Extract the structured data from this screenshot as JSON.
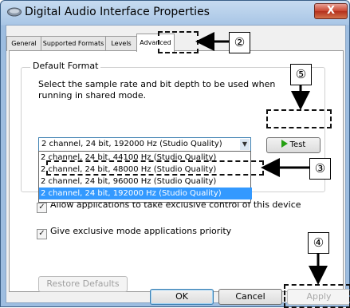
{
  "window": {
    "title": "Digital Audio Interface Properties",
    "close_label": "X"
  },
  "tabs": [
    {
      "label": "General"
    },
    {
      "label": "Supported Formats"
    },
    {
      "label": "Levels"
    },
    {
      "label": "Advanced",
      "active": true
    }
  ],
  "default_format": {
    "group_label": "Default Format",
    "description": "Select the sample rate and bit depth to be used when running in shared mode.",
    "selected_value": "2 channel, 24 bit, 192000 Hz (Studio Quality)",
    "options": [
      "2 channel, 24 bit, 44100 Hz (Studio Quality)",
      "2 channel, 24 bit, 48000 Hz (Studio Quality)",
      "2 channel, 24 bit, 96000 Hz (Studio Quality)",
      "2 channel, 24 bit, 192000 Hz (Studio Quality)"
    ],
    "highlighted_option_index": 3,
    "test_label": "Test"
  },
  "exclusive_mode": {
    "allow_label": "Allow applications to take exclusive control of this device",
    "allow_checked": true,
    "priority_label": "Give exclusive mode applications priority",
    "priority_checked": true
  },
  "buttons": {
    "restore_defaults": "Restore Defaults",
    "ok": "OK",
    "cancel": "Cancel",
    "apply": "Apply"
  },
  "callouts": {
    "c2": "②",
    "c3": "③",
    "c4": "④",
    "c5": "⑤"
  }
}
